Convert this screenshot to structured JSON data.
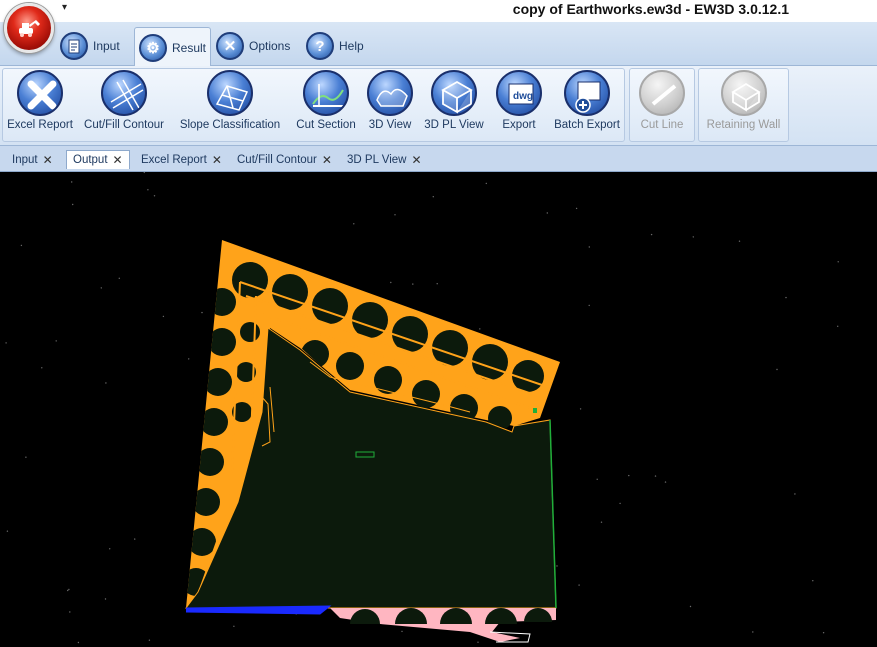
{
  "window": {
    "title": "copy of Earthworks.ew3d - EW3D 3.0.12.1",
    "qat_arrow": "▾"
  },
  "tabs": [
    {
      "label": "Input",
      "icon": "clipboard-icon",
      "active": false
    },
    {
      "label": "Result",
      "icon": "gear-icon",
      "active": true
    },
    {
      "label": "Options",
      "icon": "tools-icon",
      "active": false
    },
    {
      "label": "Help",
      "icon": "question-icon",
      "active": false
    }
  ],
  "ribbon": {
    "buttons": [
      {
        "label": "Excel Report",
        "icon": "excel-icon",
        "enabled": true
      },
      {
        "label": "Cut/Fill Contour",
        "icon": "contour-icon",
        "enabled": true
      },
      {
        "label": "Slope Classification",
        "icon": "slope-icon",
        "enabled": true
      },
      {
        "label": "Cut Section",
        "icon": "section-icon",
        "enabled": true
      },
      {
        "label": "3D View",
        "icon": "terrain-icon",
        "enabled": true
      },
      {
        "label": "3D PL View",
        "icon": "box-icon",
        "enabled": true
      },
      {
        "label": "Export",
        "icon": "export-icon",
        "enabled": true
      },
      {
        "label": "Batch Export",
        "icon": "batch-export-icon",
        "enabled": true
      },
      {
        "label": "Cut Line",
        "icon": "cut-line-icon",
        "enabled": false
      },
      {
        "label": "Retaining Wall",
        "icon": "wall-icon",
        "enabled": false
      }
    ]
  },
  "doc_tabs": [
    {
      "label": "Input",
      "active": false
    },
    {
      "label": "Output",
      "active": true
    },
    {
      "label": "Excel Report",
      "active": false
    },
    {
      "label": "Cut/Fill Contour",
      "active": false
    },
    {
      "label": "3D PL View",
      "active": false
    }
  ],
  "doc_tab_close": "✕",
  "colors": {
    "fill_orange": "#ffa31a",
    "site_fill": "#0c1a0c",
    "pink": "#ffb6c1",
    "blue_edge": "#1a2aff",
    "green_edge": "#1fae3a"
  }
}
